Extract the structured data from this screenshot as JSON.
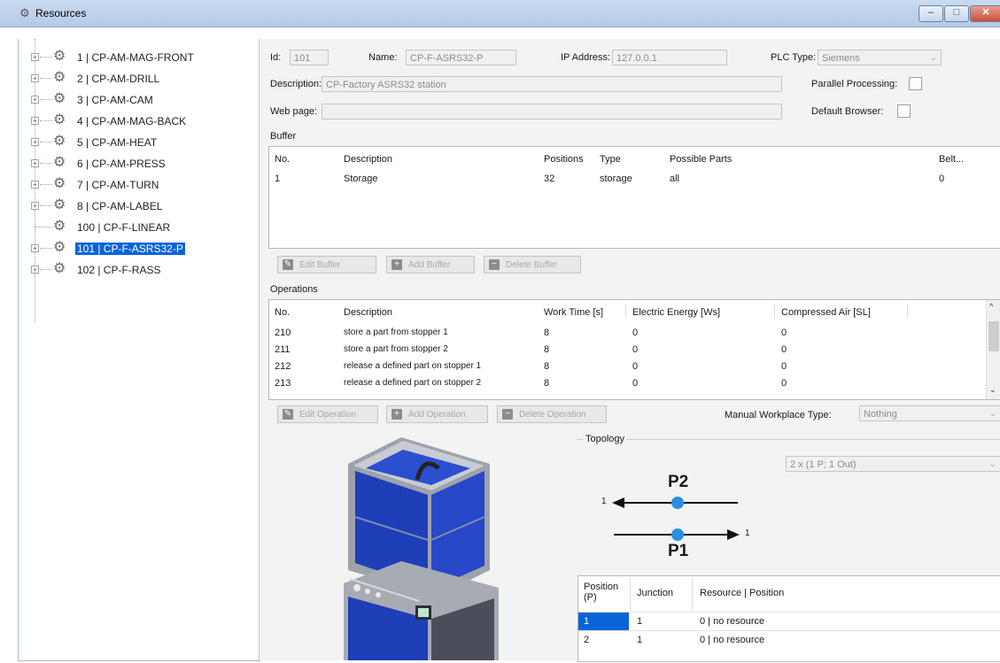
{
  "window": {
    "title": "Resources"
  },
  "tree": {
    "items": [
      {
        "label": "1 | CP-AM-MAG-FRONT",
        "expandable": true
      },
      {
        "label": "2 | CP-AM-DRILL",
        "expandable": true
      },
      {
        "label": "3 | CP-AM-CAM",
        "expandable": true
      },
      {
        "label": "4 | CP-AM-MAG-BACK",
        "expandable": true
      },
      {
        "label": "5 | CP-AM-HEAT",
        "expandable": true
      },
      {
        "label": "6 | CP-AM-PRESS",
        "expandable": true
      },
      {
        "label": "7 | CP-AM-TURN",
        "expandable": true
      },
      {
        "label": "8 | CP-AM-LABEL",
        "expandable": true
      },
      {
        "label": "100 | CP-F-LINEAR",
        "expandable": false
      },
      {
        "label": "101 | CP-F-ASRS32-P",
        "expandable": true,
        "selected": true
      },
      {
        "label": "102 | CP-F-RASS",
        "expandable": true
      }
    ]
  },
  "details": {
    "id_label": "Id:",
    "id_value": "101",
    "name_label": "Name:",
    "name_value": "CP-F-ASRS32-P",
    "ip_label": "IP Address:",
    "ip_value": "127.0.0.1",
    "plc_label": "PLC Type:",
    "plc_value": "Siemens",
    "description_label": "Description:",
    "description_value": "CP-Factory ASRS32 station",
    "webpage_label": "Web page:",
    "webpage_value": "",
    "parallel_label": "Parallel Processing:",
    "browser_label": "Default Browser:"
  },
  "buffer": {
    "title": "Buffer",
    "columns": [
      "No.",
      "Description",
      "Positions",
      "Type",
      "Possible Parts",
      "Belt..."
    ],
    "rows": [
      [
        "1",
        "Storage",
        "32",
        "storage",
        "all",
        "0"
      ]
    ],
    "buttons": {
      "edit": "Edit Buffer",
      "add": "Add Buffer",
      "delete": "Delete Buffer"
    }
  },
  "operations": {
    "title": "Operations",
    "columns": [
      "No.",
      "Description",
      "Work Time [s]",
      "Electric Energy [Ws]",
      "Compressed Air [SL]"
    ],
    "rows": [
      [
        "210",
        "store a part from stopper 1",
        "8",
        "0",
        "0"
      ],
      [
        "211",
        "store a part from stopper 2",
        "8",
        "0",
        "0"
      ],
      [
        "212",
        "release a defined part on stopper 1",
        "8",
        "0",
        "0"
      ],
      [
        "213",
        "release a defined part on stopper 2",
        "8",
        "0",
        "0"
      ]
    ],
    "buttons": {
      "edit": "Edit Operation",
      "add": "Add Operation",
      "delete": "Delete Operation"
    }
  },
  "manual_workplace": {
    "label": "Manual Workplace Type:",
    "value": "Nothing"
  },
  "topology": {
    "title": "Topology",
    "combo_value": "2 x (1 P; 1 Out)",
    "p2_label": "P2",
    "p1_label": "P1",
    "left_out": "1",
    "right_out": "1",
    "table_columns": [
      "Position (P)",
      "Junction",
      "Resource | Position"
    ],
    "table_rows": [
      [
        "1",
        "1",
        "0 | no resource"
      ],
      [
        "2",
        "1",
        "0 | no resource"
      ]
    ]
  },
  "colors": {
    "selection": "#0a64d8",
    "node": "#2a8fe0",
    "machine_blue": "#1f3fb8"
  },
  "icons": {
    "tree_node": "gear-icon",
    "edit": "edit-icon",
    "add": "plus-icon",
    "delete": "minus-icon"
  }
}
